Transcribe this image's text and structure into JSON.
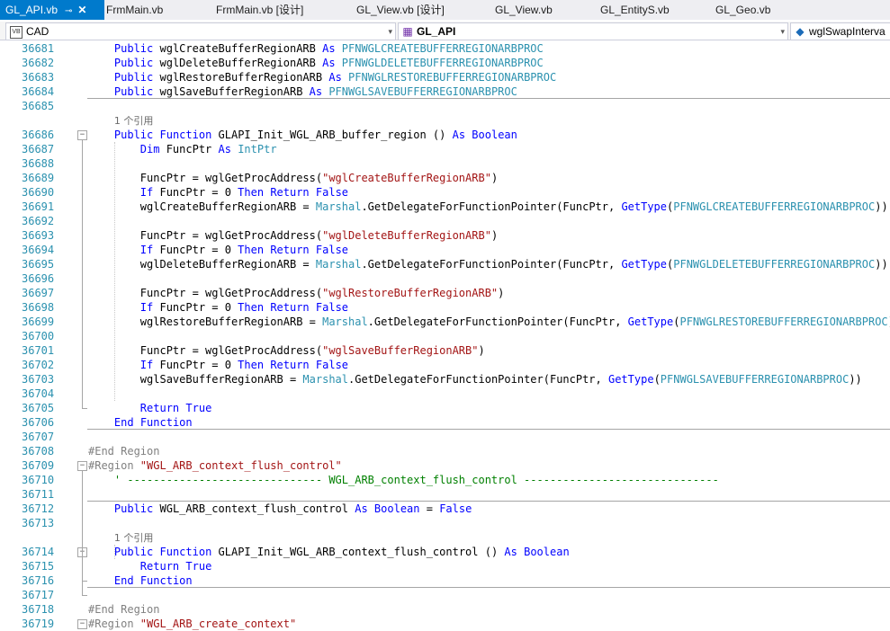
{
  "tabs": [
    {
      "label": "GL_API.vb",
      "active": true,
      "pin": "⊸",
      "close": "✕"
    },
    {
      "label": "FrmMain.vb"
    },
    {
      "label": "FrmMain.vb [设计]"
    },
    {
      "label": "GL_View.vb [设计]"
    },
    {
      "label": "GL_View.vb"
    },
    {
      "label": "GL_EntityS.vb"
    },
    {
      "label": "GL_Geo.vb"
    }
  ],
  "navbar": {
    "project": "CAD",
    "project_icon": "VB",
    "class": "GL_API",
    "member": "wglSwapInterva"
  },
  "colors": {
    "accent": "#007acc",
    "keyword": "#0000ff",
    "type": "#2b91af",
    "string": "#a31515",
    "comment": "#008000"
  },
  "lines": [
    {
      "n": "36681",
      "t": [
        [
          "    ",
          ""
        ],
        [
          "Public",
          "kw"
        ],
        [
          " wglCreateBufferRegionARB ",
          ""
        ],
        [
          "As",
          "kw"
        ],
        [
          " PFNWGLCREATEBUFFERREGIONARBPROC",
          "ty"
        ]
      ]
    },
    {
      "n": "36682",
      "t": [
        [
          "    ",
          ""
        ],
        [
          "Public",
          "kw"
        ],
        [
          " wglDeleteBufferRegionARB ",
          ""
        ],
        [
          "As",
          "kw"
        ],
        [
          " PFNWGLDELETEBUFFERREGIONARBPROC",
          "ty"
        ]
      ]
    },
    {
      "n": "36683",
      "t": [
        [
          "    ",
          ""
        ],
        [
          "Public",
          "kw"
        ],
        [
          " wglRestoreBufferRegionARB ",
          ""
        ],
        [
          "As",
          "kw"
        ],
        [
          " PFNWGLRESTOREBUFFERREGIONARBPROC",
          "ty"
        ]
      ]
    },
    {
      "n": "36684",
      "t": [
        [
          "    ",
          ""
        ],
        [
          "Public",
          "kw"
        ],
        [
          " wglSaveBufferRegionARB ",
          ""
        ],
        [
          "As",
          "kw"
        ],
        [
          " PFNWGLSAVEBUFFERREGIONARBPROC",
          "ty"
        ]
      ]
    },
    {
      "n": "36685",
      "t": []
    },
    {
      "n": "",
      "t": [
        [
          "    ",
          ""
        ],
        [
          "1 个引用",
          "ref"
        ]
      ]
    },
    {
      "n": "36686",
      "fold": "−",
      "t": [
        [
          "    ",
          ""
        ],
        [
          "Public",
          "kw"
        ],
        [
          " ",
          ""
        ],
        [
          "Function",
          "kw"
        ],
        [
          " GLAPI_Init_WGL_ARB_buffer_region () ",
          ""
        ],
        [
          "As",
          "kw"
        ],
        [
          " ",
          ""
        ],
        [
          "Boolean",
          "kw"
        ]
      ]
    },
    {
      "n": "36687",
      "t": [
        [
          "        ",
          ""
        ],
        [
          "Dim",
          "kw"
        ],
        [
          " FuncPtr ",
          ""
        ],
        [
          "As",
          "kw"
        ],
        [
          " ",
          ""
        ],
        [
          "IntPtr",
          "ty"
        ]
      ]
    },
    {
      "n": "36688",
      "t": []
    },
    {
      "n": "36689",
      "t": [
        [
          "        FuncPtr = wglGetProcAddress(",
          ""
        ],
        [
          "\"wglCreateBufferRegionARB\"",
          "st"
        ],
        [
          ")",
          ""
        ]
      ]
    },
    {
      "n": "36690",
      "t": [
        [
          "        ",
          ""
        ],
        [
          "If",
          "kw"
        ],
        [
          " FuncPtr = 0 ",
          ""
        ],
        [
          "Then",
          "kw"
        ],
        [
          " ",
          ""
        ],
        [
          "Return",
          "kw"
        ],
        [
          " ",
          ""
        ],
        [
          "False",
          "kw"
        ]
      ]
    },
    {
      "n": "36691",
      "t": [
        [
          "        wglCreateBufferRegionARB = ",
          ""
        ],
        [
          "Marshal",
          "ty"
        ],
        [
          ".GetDelegateForFunctionPointer(FuncPtr, ",
          ""
        ],
        [
          "GetType",
          "kw"
        ],
        [
          "(",
          ""
        ],
        [
          "PFNWGLCREATEBUFFERREGIONARBPROC",
          "ty"
        ],
        [
          "))",
          ""
        ]
      ]
    },
    {
      "n": "36692",
      "t": []
    },
    {
      "n": "36693",
      "t": [
        [
          "        FuncPtr = wglGetProcAddress(",
          ""
        ],
        [
          "\"wglDeleteBufferRegionARB\"",
          "st"
        ],
        [
          ")",
          ""
        ]
      ]
    },
    {
      "n": "36694",
      "t": [
        [
          "        ",
          ""
        ],
        [
          "If",
          "kw"
        ],
        [
          " FuncPtr = 0 ",
          ""
        ],
        [
          "Then",
          "kw"
        ],
        [
          " ",
          ""
        ],
        [
          "Return",
          "kw"
        ],
        [
          " ",
          ""
        ],
        [
          "False",
          "kw"
        ]
      ]
    },
    {
      "n": "36695",
      "t": [
        [
          "        wglDeleteBufferRegionARB = ",
          ""
        ],
        [
          "Marshal",
          "ty"
        ],
        [
          ".GetDelegateForFunctionPointer(FuncPtr, ",
          ""
        ],
        [
          "GetType",
          "kw"
        ],
        [
          "(",
          ""
        ],
        [
          "PFNWGLDELETEBUFFERREGIONARBPROC",
          "ty"
        ],
        [
          "))",
          ""
        ]
      ]
    },
    {
      "n": "36696",
      "t": []
    },
    {
      "n": "36697",
      "t": [
        [
          "        FuncPtr = wglGetProcAddress(",
          ""
        ],
        [
          "\"wglRestoreBufferRegionARB\"",
          "st"
        ],
        [
          ")",
          ""
        ]
      ]
    },
    {
      "n": "36698",
      "t": [
        [
          "        ",
          ""
        ],
        [
          "If",
          "kw"
        ],
        [
          " FuncPtr = 0 ",
          ""
        ],
        [
          "Then",
          "kw"
        ],
        [
          " ",
          ""
        ],
        [
          "Return",
          "kw"
        ],
        [
          " ",
          ""
        ],
        [
          "False",
          "kw"
        ]
      ]
    },
    {
      "n": "36699",
      "t": [
        [
          "        wglRestoreBufferRegionARB = ",
          ""
        ],
        [
          "Marshal",
          "ty"
        ],
        [
          ".GetDelegateForFunctionPointer(FuncPtr, ",
          ""
        ],
        [
          "GetType",
          "kw"
        ],
        [
          "(",
          ""
        ],
        [
          "PFNWGLRESTOREBUFFERREGIONARBPROC",
          "ty"
        ],
        [
          "))",
          ""
        ]
      ]
    },
    {
      "n": "36700",
      "t": []
    },
    {
      "n": "36701",
      "t": [
        [
          "        FuncPtr = wglGetProcAddress(",
          ""
        ],
        [
          "\"wglSaveBufferRegionARB\"",
          "st"
        ],
        [
          ")",
          ""
        ]
      ]
    },
    {
      "n": "36702",
      "t": [
        [
          "        ",
          ""
        ],
        [
          "If",
          "kw"
        ],
        [
          " FuncPtr = 0 ",
          ""
        ],
        [
          "Then",
          "kw"
        ],
        [
          " ",
          ""
        ],
        [
          "Return",
          "kw"
        ],
        [
          " ",
          ""
        ],
        [
          "False",
          "kw"
        ]
      ]
    },
    {
      "n": "36703",
      "t": [
        [
          "        wglSaveBufferRegionARB = ",
          ""
        ],
        [
          "Marshal",
          "ty"
        ],
        [
          ".GetDelegateForFunctionPointer(FuncPtr, ",
          ""
        ],
        [
          "GetType",
          "kw"
        ],
        [
          "(",
          ""
        ],
        [
          "PFNWGLSAVEBUFFERREGIONARBPROC",
          "ty"
        ],
        [
          "))",
          ""
        ]
      ]
    },
    {
      "n": "36704",
      "t": []
    },
    {
      "n": "36705",
      "t": [
        [
          "        ",
          ""
        ],
        [
          "Return",
          "kw"
        ],
        [
          " ",
          ""
        ],
        [
          "True",
          "kw"
        ]
      ]
    },
    {
      "n": "36706",
      "t": [
        [
          "    ",
          ""
        ],
        [
          "End",
          "kw"
        ],
        [
          " ",
          ""
        ],
        [
          "Function",
          "kw"
        ]
      ]
    },
    {
      "n": "36707",
      "t": []
    },
    {
      "n": "36708",
      "t": [
        [
          "#End Region",
          "gr"
        ]
      ]
    },
    {
      "n": "36709",
      "fold": "−",
      "t": [
        [
          "#Region ",
          "gr"
        ],
        [
          "\"WGL_ARB_context_flush_control\"",
          "st"
        ]
      ]
    },
    {
      "n": "36710",
      "t": [
        [
          "    ",
          ""
        ],
        [
          "' ------------------------------ WGL_ARB_context_flush_control ------------------------------",
          "cm"
        ]
      ]
    },
    {
      "n": "36711",
      "t": []
    },
    {
      "n": "36712",
      "t": [
        [
          "    ",
          ""
        ],
        [
          "Public",
          "kw"
        ],
        [
          " WGL_ARB_context_flush_control ",
          ""
        ],
        [
          "As",
          "kw"
        ],
        [
          " ",
          ""
        ],
        [
          "Boolean",
          "kw"
        ],
        [
          " = ",
          ""
        ],
        [
          "False",
          "kw"
        ]
      ]
    },
    {
      "n": "36713",
      "t": []
    },
    {
      "n": "",
      "t": [
        [
          "    ",
          ""
        ],
        [
          "1 个引用",
          "ref"
        ]
      ]
    },
    {
      "n": "36714",
      "fold": "−",
      "t": [
        [
          "    ",
          ""
        ],
        [
          "Public",
          "kw"
        ],
        [
          " ",
          ""
        ],
        [
          "Function",
          "kw"
        ],
        [
          " GLAPI_Init_WGL_ARB_context_flush_control () ",
          ""
        ],
        [
          "As",
          "kw"
        ],
        [
          " ",
          ""
        ],
        [
          "Boolean",
          "kw"
        ]
      ]
    },
    {
      "n": "36715",
      "t": [
        [
          "        ",
          ""
        ],
        [
          "Return",
          "kw"
        ],
        [
          " ",
          ""
        ],
        [
          "True",
          "kw"
        ]
      ]
    },
    {
      "n": "36716",
      "t": [
        [
          "    ",
          ""
        ],
        [
          "End",
          "kw"
        ],
        [
          " ",
          ""
        ],
        [
          "Function",
          "kw"
        ]
      ]
    },
    {
      "n": "36717",
      "t": []
    },
    {
      "n": "36718",
      "t": [
        [
          "#End Region",
          "gr"
        ]
      ]
    },
    {
      "n": "36719",
      "fold": "−",
      "t": [
        [
          "#Region ",
          "gr"
        ],
        [
          "\"WGL_ARB_create_context\"",
          "st"
        ]
      ]
    }
  ]
}
